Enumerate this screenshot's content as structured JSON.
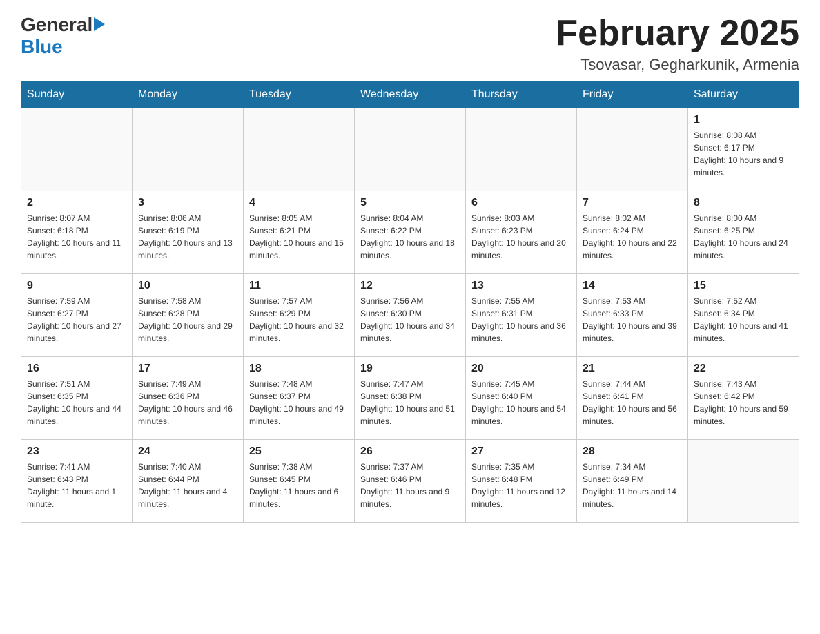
{
  "logo": {
    "general": "General",
    "blue": "Blue"
  },
  "header": {
    "month_year": "February 2025",
    "location": "Tsovasar, Gegharkunik, Armenia"
  },
  "weekdays": [
    "Sunday",
    "Monday",
    "Tuesday",
    "Wednesday",
    "Thursday",
    "Friday",
    "Saturday"
  ],
  "weeks": [
    [
      {
        "day": "",
        "sunrise": "",
        "sunset": "",
        "daylight": ""
      },
      {
        "day": "",
        "sunrise": "",
        "sunset": "",
        "daylight": ""
      },
      {
        "day": "",
        "sunrise": "",
        "sunset": "",
        "daylight": ""
      },
      {
        "day": "",
        "sunrise": "",
        "sunset": "",
        "daylight": ""
      },
      {
        "day": "",
        "sunrise": "",
        "sunset": "",
        "daylight": ""
      },
      {
        "day": "",
        "sunrise": "",
        "sunset": "",
        "daylight": ""
      },
      {
        "day": "1",
        "sunrise": "Sunrise: 8:08 AM",
        "sunset": "Sunset: 6:17 PM",
        "daylight": "Daylight: 10 hours and 9 minutes."
      }
    ],
    [
      {
        "day": "2",
        "sunrise": "Sunrise: 8:07 AM",
        "sunset": "Sunset: 6:18 PM",
        "daylight": "Daylight: 10 hours and 11 minutes."
      },
      {
        "day": "3",
        "sunrise": "Sunrise: 8:06 AM",
        "sunset": "Sunset: 6:19 PM",
        "daylight": "Daylight: 10 hours and 13 minutes."
      },
      {
        "day": "4",
        "sunrise": "Sunrise: 8:05 AM",
        "sunset": "Sunset: 6:21 PM",
        "daylight": "Daylight: 10 hours and 15 minutes."
      },
      {
        "day": "5",
        "sunrise": "Sunrise: 8:04 AM",
        "sunset": "Sunset: 6:22 PM",
        "daylight": "Daylight: 10 hours and 18 minutes."
      },
      {
        "day": "6",
        "sunrise": "Sunrise: 8:03 AM",
        "sunset": "Sunset: 6:23 PM",
        "daylight": "Daylight: 10 hours and 20 minutes."
      },
      {
        "day": "7",
        "sunrise": "Sunrise: 8:02 AM",
        "sunset": "Sunset: 6:24 PM",
        "daylight": "Daylight: 10 hours and 22 minutes."
      },
      {
        "day": "8",
        "sunrise": "Sunrise: 8:00 AM",
        "sunset": "Sunset: 6:25 PM",
        "daylight": "Daylight: 10 hours and 24 minutes."
      }
    ],
    [
      {
        "day": "9",
        "sunrise": "Sunrise: 7:59 AM",
        "sunset": "Sunset: 6:27 PM",
        "daylight": "Daylight: 10 hours and 27 minutes."
      },
      {
        "day": "10",
        "sunrise": "Sunrise: 7:58 AM",
        "sunset": "Sunset: 6:28 PM",
        "daylight": "Daylight: 10 hours and 29 minutes."
      },
      {
        "day": "11",
        "sunrise": "Sunrise: 7:57 AM",
        "sunset": "Sunset: 6:29 PM",
        "daylight": "Daylight: 10 hours and 32 minutes."
      },
      {
        "day": "12",
        "sunrise": "Sunrise: 7:56 AM",
        "sunset": "Sunset: 6:30 PM",
        "daylight": "Daylight: 10 hours and 34 minutes."
      },
      {
        "day": "13",
        "sunrise": "Sunrise: 7:55 AM",
        "sunset": "Sunset: 6:31 PM",
        "daylight": "Daylight: 10 hours and 36 minutes."
      },
      {
        "day": "14",
        "sunrise": "Sunrise: 7:53 AM",
        "sunset": "Sunset: 6:33 PM",
        "daylight": "Daylight: 10 hours and 39 minutes."
      },
      {
        "day": "15",
        "sunrise": "Sunrise: 7:52 AM",
        "sunset": "Sunset: 6:34 PM",
        "daylight": "Daylight: 10 hours and 41 minutes."
      }
    ],
    [
      {
        "day": "16",
        "sunrise": "Sunrise: 7:51 AM",
        "sunset": "Sunset: 6:35 PM",
        "daylight": "Daylight: 10 hours and 44 minutes."
      },
      {
        "day": "17",
        "sunrise": "Sunrise: 7:49 AM",
        "sunset": "Sunset: 6:36 PM",
        "daylight": "Daylight: 10 hours and 46 minutes."
      },
      {
        "day": "18",
        "sunrise": "Sunrise: 7:48 AM",
        "sunset": "Sunset: 6:37 PM",
        "daylight": "Daylight: 10 hours and 49 minutes."
      },
      {
        "day": "19",
        "sunrise": "Sunrise: 7:47 AM",
        "sunset": "Sunset: 6:38 PM",
        "daylight": "Daylight: 10 hours and 51 minutes."
      },
      {
        "day": "20",
        "sunrise": "Sunrise: 7:45 AM",
        "sunset": "Sunset: 6:40 PM",
        "daylight": "Daylight: 10 hours and 54 minutes."
      },
      {
        "day": "21",
        "sunrise": "Sunrise: 7:44 AM",
        "sunset": "Sunset: 6:41 PM",
        "daylight": "Daylight: 10 hours and 56 minutes."
      },
      {
        "day": "22",
        "sunrise": "Sunrise: 7:43 AM",
        "sunset": "Sunset: 6:42 PM",
        "daylight": "Daylight: 10 hours and 59 minutes."
      }
    ],
    [
      {
        "day": "23",
        "sunrise": "Sunrise: 7:41 AM",
        "sunset": "Sunset: 6:43 PM",
        "daylight": "Daylight: 11 hours and 1 minute."
      },
      {
        "day": "24",
        "sunrise": "Sunrise: 7:40 AM",
        "sunset": "Sunset: 6:44 PM",
        "daylight": "Daylight: 11 hours and 4 minutes."
      },
      {
        "day": "25",
        "sunrise": "Sunrise: 7:38 AM",
        "sunset": "Sunset: 6:45 PM",
        "daylight": "Daylight: 11 hours and 6 minutes."
      },
      {
        "day": "26",
        "sunrise": "Sunrise: 7:37 AM",
        "sunset": "Sunset: 6:46 PM",
        "daylight": "Daylight: 11 hours and 9 minutes."
      },
      {
        "day": "27",
        "sunrise": "Sunrise: 7:35 AM",
        "sunset": "Sunset: 6:48 PM",
        "daylight": "Daylight: 11 hours and 12 minutes."
      },
      {
        "day": "28",
        "sunrise": "Sunrise: 7:34 AM",
        "sunset": "Sunset: 6:49 PM",
        "daylight": "Daylight: 11 hours and 14 minutes."
      },
      {
        "day": "",
        "sunrise": "",
        "sunset": "",
        "daylight": ""
      }
    ]
  ]
}
